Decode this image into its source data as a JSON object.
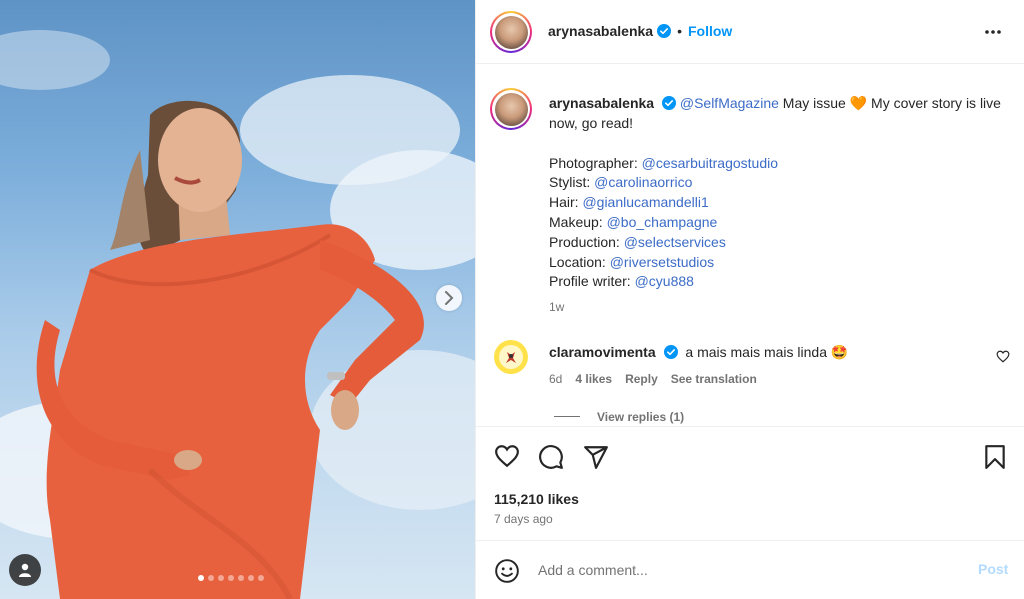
{
  "post": {
    "author": "arynasabalenka",
    "follow_label": "Follow",
    "bullet": "•",
    "avatar_icon": "profile-photo",
    "verified_color": "#0095f6",
    "caption": {
      "mention_magazine": "@SelfMagazine",
      "text_1": " May issue ",
      "emoji_heart": "🧡",
      "text_2": " My cover story is live now, go read!",
      "credits": [
        {
          "label": "Photographer: ",
          "handle": "@cesarbuitragostudio"
        },
        {
          "label": "Stylist: ",
          "handle": "@carolinaorrico"
        },
        {
          "label": "Hair: ",
          "handle": "@gianlucamandelli1"
        },
        {
          "label": "Makeup: ",
          "handle": "@bo_champagne"
        },
        {
          "label": "Production: ",
          "handle": "@selectservices"
        },
        {
          "label": "Location: ",
          "handle": "@riversetstudios"
        },
        {
          "label": "Profile writer: ",
          "handle": "@cyu888"
        }
      ],
      "age": "1w"
    },
    "carousel": {
      "slide_count": 7,
      "active_index": 0
    }
  },
  "comment": {
    "author": "claramovimenta",
    "text": "a mais mais mais linda 🤩",
    "age": "6d",
    "likes": "4 likes",
    "reply_label": "Reply",
    "translation_label": "See translation",
    "view_replies": "View replies (1)"
  },
  "engagement": {
    "likes": "115,210 likes",
    "posted": "7 days ago"
  },
  "composer": {
    "placeholder": "Add a comment...",
    "post_label": "Post"
  },
  "colors": {
    "accent": "#0095f6",
    "mention": "#3c6cc7",
    "dress": "#e8613f",
    "post_disabled": "#b3dbff"
  }
}
